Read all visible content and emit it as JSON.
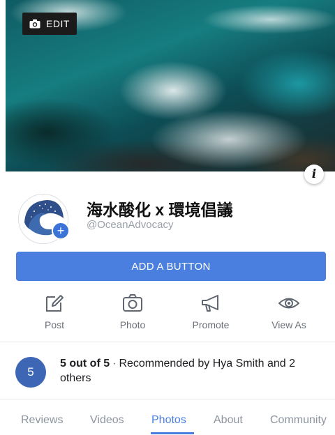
{
  "cover": {
    "edit_label": "EDIT",
    "info_label": "i"
  },
  "profile": {
    "name": "海水酸化 x 環境倡議",
    "handle": "@OceanAdvocacy",
    "add_button_label": "ADD A BUTTON"
  },
  "actions": [
    {
      "label": "Post",
      "icon": "edit-icon"
    },
    {
      "label": "Photo",
      "icon": "camera-icon"
    },
    {
      "label": "Promote",
      "icon": "megaphone-icon"
    },
    {
      "label": "View As",
      "icon": "eye-icon"
    }
  ],
  "recommendation": {
    "rating": "5",
    "score_text": "5 out of 5",
    "separator": "·",
    "detail_text": "Recommended by Hya  Smith and 2 others"
  },
  "tabs": [
    {
      "label": "Reviews",
      "active": false
    },
    {
      "label": "Videos",
      "active": false
    },
    {
      "label": "Photos",
      "active": true
    },
    {
      "label": "About",
      "active": false
    },
    {
      "label": "Community",
      "active": false
    }
  ],
  "colors": {
    "accent": "#4a7fdf",
    "rating_badge": "#3d66b5",
    "muted_text": "#8d949e"
  }
}
